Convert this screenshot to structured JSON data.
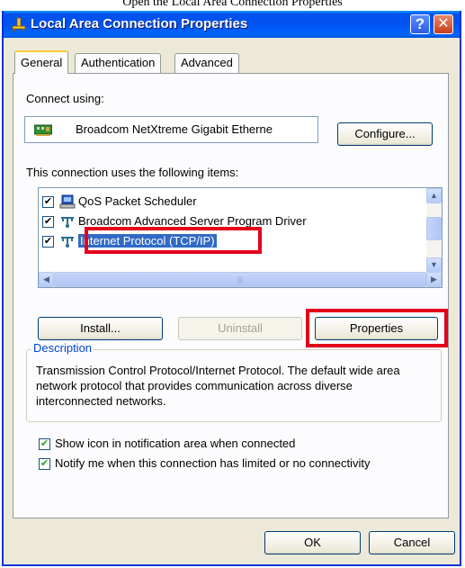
{
  "caption": "Open the Local Area Connection Properties",
  "window": {
    "title": "Local Area Connection Properties",
    "help_glyph": "?",
    "close_glyph": "✕"
  },
  "tabs": [
    {
      "label": "General",
      "active": true
    },
    {
      "label": "Authentication",
      "active": false
    },
    {
      "label": "Advanced",
      "active": false
    }
  ],
  "connect_using": {
    "label": "Connect using:",
    "adapter": "Broadcom NetXtreme Gigabit Etherne",
    "configure_button": "Configure..."
  },
  "items_label": "This connection uses the following items:",
  "items": [
    {
      "label": "QoS Packet Scheduler",
      "checked": true,
      "icon": "qos-scheduler-icon"
    },
    {
      "label": "Broadcom Advanced Server Program Driver",
      "checked": true,
      "icon": "network-protocol-icon"
    },
    {
      "label": "Internet Protocol (TCP/IP)",
      "checked": true,
      "icon": "network-protocol-icon",
      "selected": true
    }
  ],
  "buttons": {
    "install": "Install...",
    "uninstall": "Uninstall",
    "properties": "Properties",
    "ok": "OK",
    "cancel": "Cancel"
  },
  "description": {
    "legend": "Description",
    "text": "Transmission Control Protocol/Internet Protocol. The default wide area network protocol that provides communication across diverse interconnected networks."
  },
  "options": [
    {
      "label": "Show icon in notification area when connected",
      "checked": true
    },
    {
      "label": "Notify me when this connection has limited or no connectivity",
      "checked": true
    }
  ],
  "colors": {
    "titlebar": "#0053ee",
    "highlight": "#e3001b",
    "selection": "#316ac5",
    "description_legend": "#0046d5"
  }
}
